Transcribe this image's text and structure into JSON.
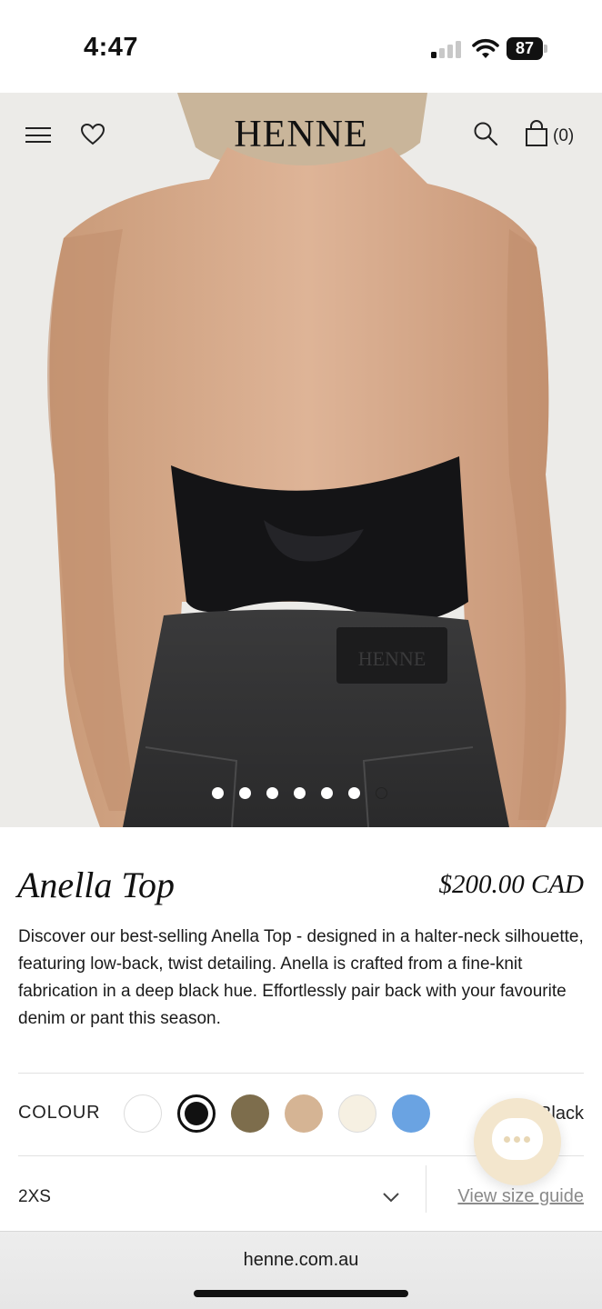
{
  "status_bar": {
    "time": "4:47",
    "battery": "87"
  },
  "header": {
    "logo": "HENNE",
    "cart_count": "(0)"
  },
  "gallery": {
    "total_images": 7,
    "active_index": 6
  },
  "product": {
    "title": "Anella Top",
    "price": "$200.00 CAD",
    "description": "Discover our best-selling Anella Top - designed in a halter-neck silhouette, featuring low-back, twist detailing. Anella is crafted from a fine-knit fabrication in a deep black hue. Effortlessly pair back with your favourite denim or pant this season."
  },
  "colour": {
    "label": "COLOUR",
    "selected_name": "Black",
    "swatches": [
      {
        "color": "#ffffff",
        "selected": false
      },
      {
        "color": "#111111",
        "selected": true
      },
      {
        "color": "#7d6d4c",
        "selected": false
      },
      {
        "color": "#d5b494",
        "selected": false
      },
      {
        "color": "#f6f0e2",
        "selected": false
      },
      {
        "color": "#6aa3e2",
        "selected": false
      }
    ]
  },
  "size": {
    "value": "2XS",
    "size_guide_label": "View size guide"
  },
  "browser": {
    "url": "henne.com.au"
  }
}
